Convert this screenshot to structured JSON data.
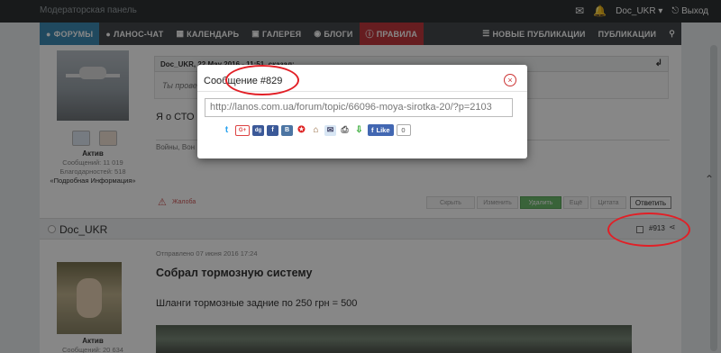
{
  "topbar": {
    "brand": "Модераторская панель",
    "username": "Doc_UKR",
    "logout": "Выход"
  },
  "nav": {
    "forums": "ФОРУМЫ",
    "chat": "ЛАНОС-ЧАТ",
    "calendar": "КАЛЕНДАРЬ",
    "gallery": "ГАЛЕРЕЯ",
    "blogs": "БЛОГИ",
    "rules": "ПРАВИЛА",
    "new_posts": "НОВЫЕ ПУБЛИКАЦИИ",
    "publications": "ПУБЛИКАЦИИ"
  },
  "post1": {
    "rank": "Актив",
    "posts": "Сообщений: 11 019",
    "thanks": "Благодарностей: 518",
    "more_info": "«Подробная Информация»",
    "quote_header": "Doc_UKR, 22 May 2016 - 11:51, сказал:",
    "quote_text": "Ты прове",
    "text": "Я о СТО н",
    "signature": "Войны, Вон",
    "actions": {
      "complaint": "Жалоба",
      "hide": "Скрыть",
      "edit": "Изменить",
      "delete": "Удалить",
      "multi": "Ещё",
      "quote": "Цитата",
      "reply": "Ответить"
    }
  },
  "post2": {
    "author": "Doc_UKR",
    "number": "#913",
    "sent": "Отправлено 07 июня 2016 17:24",
    "title": "Собрал тормозную систему",
    "body": "Шланги тормозные задние по 250 грн = 500",
    "rank": "Актив",
    "posts": "Сообщений: 20 634"
  },
  "modal": {
    "title": "Сообщение #829",
    "close": "×",
    "url": "http://lanos.com.ua/forum/topic/66096-moya-sirotka-20/?p=2103",
    "like_label": "Like",
    "like_count": "0"
  },
  "colors": {
    "accent": "#3d8ab3",
    "rules": "#c0383d",
    "annotation": "#e21f26"
  }
}
